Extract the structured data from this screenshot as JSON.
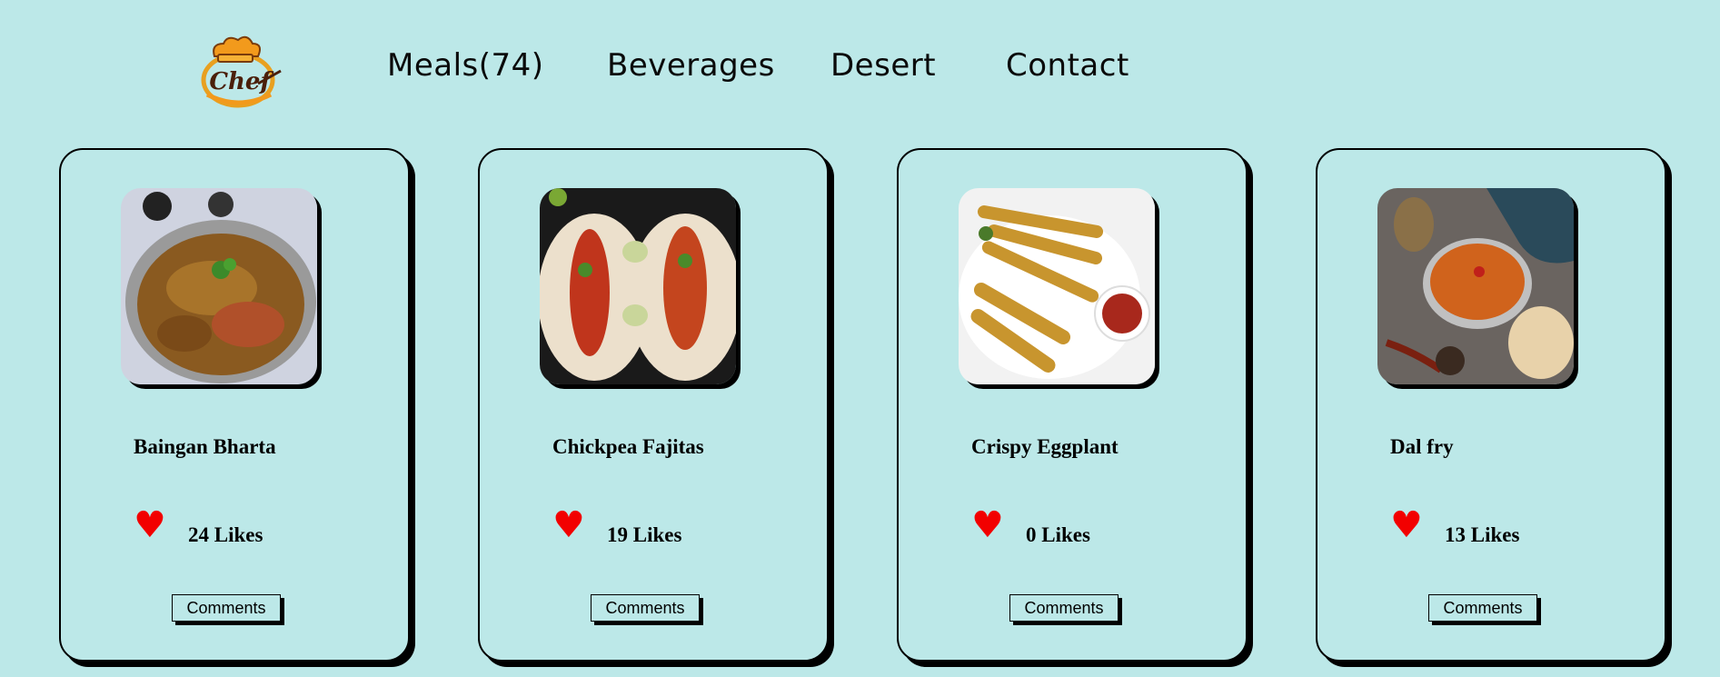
{
  "logo": {
    "text": "Chef"
  },
  "nav": {
    "meals": "Meals(74)",
    "beverages": "Beverages",
    "desert": "Desert",
    "contact": "Contact"
  },
  "cards": [
    {
      "title": "Baingan Bharta",
      "likes": "24 Likes",
      "heart": "♥",
      "comments": "Comments"
    },
    {
      "title": "Chickpea Fajitas",
      "likes": "19 Likes",
      "heart": "♥",
      "comments": "Comments"
    },
    {
      "title": "Crispy Eggplant",
      "likes": "0 Likes",
      "heart": "♥",
      "comments": "Comments"
    },
    {
      "title": "Dal fry",
      "likes": "13 Likes",
      "heart": "♥",
      "comments": "Comments"
    }
  ]
}
